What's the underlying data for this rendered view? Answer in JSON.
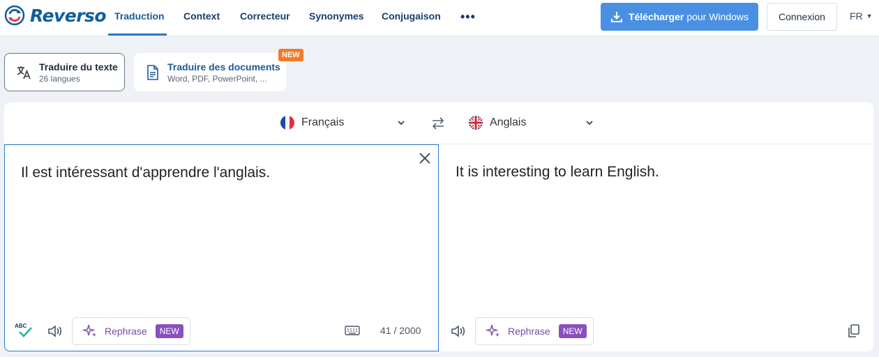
{
  "header": {
    "logo": "Reverso",
    "nav": [
      "Traduction",
      "Context",
      "Correcteur",
      "Synonymes",
      "Conjugaison"
    ],
    "more": "•••",
    "download": {
      "bold": "Télécharger",
      "rest": "pour Windows"
    },
    "login": "Connexion",
    "ui_lang": "FR"
  },
  "modes": {
    "text": {
      "title": "Traduire du texte",
      "subtitle": "26 langues"
    },
    "docs": {
      "title": "Traduire des documents",
      "subtitle": "Word, PDF, PowerPoint, ...",
      "badge": "NEW"
    }
  },
  "translator": {
    "source_lang": "Français",
    "target_lang": "Anglais",
    "source_text": "Il est intéressant d'apprendre l'anglais.",
    "target_text": "It is interesting to learn English.",
    "spell_label": "ABC",
    "rephrase_label": "Rephrase",
    "rephrase_badge": "NEW",
    "char_count": "41 / 2000"
  },
  "colors": {
    "accent": "#4a90e2",
    "brand": "#0f5e9c",
    "new_orange": "#f47a2a",
    "rephrase_purple": "#8a4fbf"
  },
  "icons": [
    "reverso-logo-icon",
    "download-icon",
    "translate-icon",
    "document-icon",
    "chevron-down-icon",
    "swap-icon",
    "close-icon",
    "spellcheck-icon",
    "speaker-icon",
    "sparkle-icon",
    "keyboard-icon",
    "copy-icon"
  ]
}
